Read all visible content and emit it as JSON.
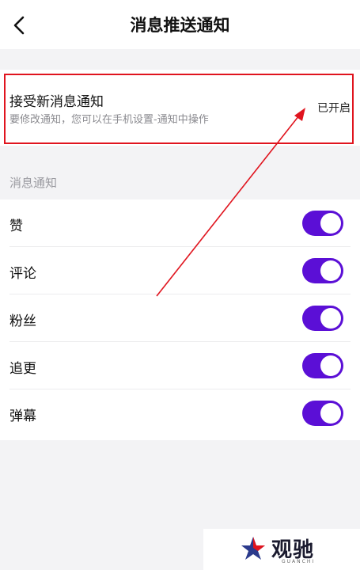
{
  "header": {
    "title": "消息推送通知",
    "back_icon": "chevron-left-icon"
  },
  "accept": {
    "title": "接受新消息通知",
    "subtitle": "要修改通知，您可以在手机设置-通知中操作",
    "status": "已开启"
  },
  "section": {
    "title": "消息通知"
  },
  "items": [
    {
      "label": "赞",
      "enabled": true
    },
    {
      "label": "评论",
      "enabled": true
    },
    {
      "label": "粉丝",
      "enabled": true
    },
    {
      "label": "追更",
      "enabled": true
    },
    {
      "label": "弹幕",
      "enabled": true
    }
  ],
  "colors": {
    "toggle_on": "#5b0fd6",
    "annotation": "#e0141e"
  },
  "watermark": {
    "text": "观驰",
    "sub": "GUANCHI"
  }
}
